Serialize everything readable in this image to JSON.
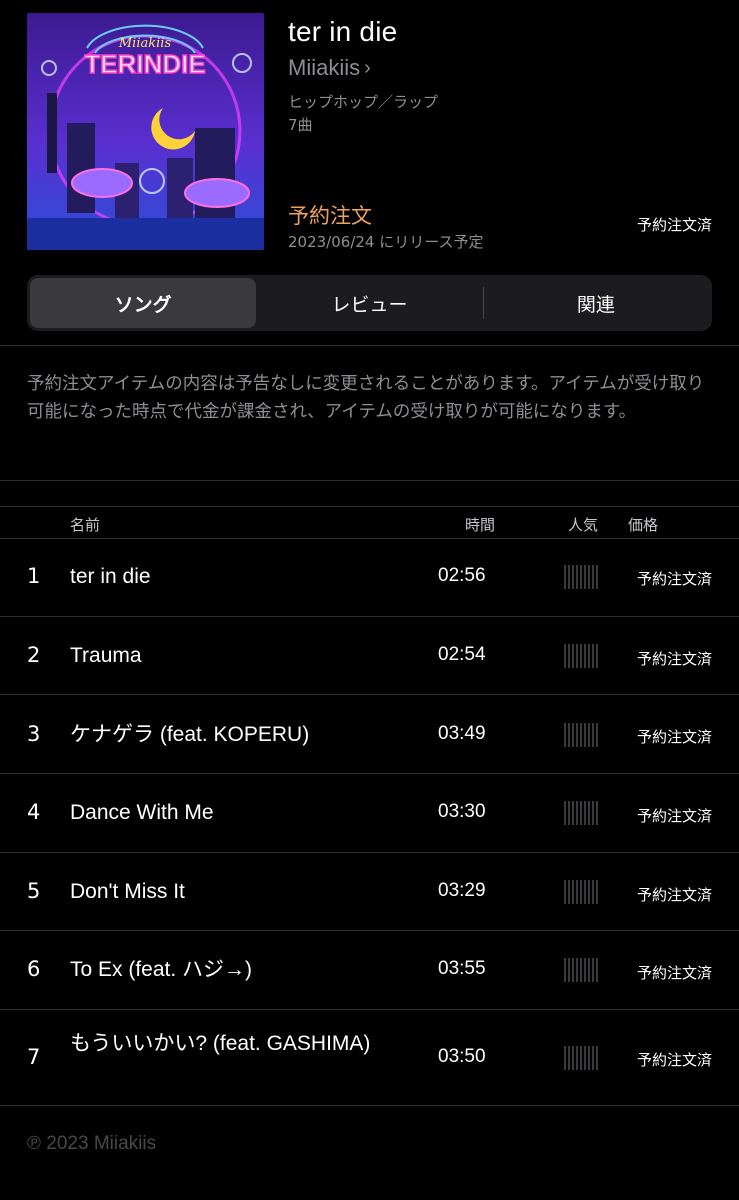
{
  "album": {
    "title": "ter in die",
    "artist": "Miiakiis",
    "genre": "ヒップホップ／ラップ",
    "track_count": "7曲",
    "preorder_label": "予約注文",
    "release_date": "2023/06/24 にリリース予定",
    "preorder_status": "予約注文済",
    "artwork_logo_small": "Miiakiis",
    "artwork_logo_big": "TERINDIE"
  },
  "tabs": [
    {
      "label": "ソング",
      "active": true
    },
    {
      "label": "レビュー",
      "active": false
    },
    {
      "label": "関連",
      "active": false
    }
  ],
  "notice": "予約注文アイテムの内容は予告なしに変更されることがあります。アイテムが受け取り可能になった時点で代金が課金され、アイテムの受け取りが可能になります。",
  "columns": {
    "name": "名前",
    "time": "時間",
    "popularity": "人気",
    "price": "価格"
  },
  "tracks": [
    {
      "num": "1",
      "name": "ter in die",
      "duration": "02:56",
      "price": "予約注文済"
    },
    {
      "num": "2",
      "name": "Trauma",
      "duration": "02:54",
      "price": "予約注文済"
    },
    {
      "num": "3",
      "name": "ケナゲラ (feat. KOPERU)",
      "duration": "03:49",
      "price": "予約注文済"
    },
    {
      "num": "4",
      "name": "Dance With Me",
      "duration": "03:30",
      "price": "予約注文済"
    },
    {
      "num": "5",
      "name": "Don't Miss It",
      "duration": "03:29",
      "price": "予約注文済"
    },
    {
      "num": "6",
      "name": "To Ex (feat. ハジ→)",
      "duration": "03:55",
      "price": "予約注文済"
    },
    {
      "num": "7",
      "name": "もういいかい? (feat. GASHIMA)",
      "duration": "03:50",
      "price": "予約注文済"
    }
  ],
  "copyright": "℗ 2023 Miiakiis",
  "colors": {
    "background": "#000000",
    "accent_preorder": "#f0a35e",
    "secondary_text": "#8e8e93",
    "segment_bg": "#1c1c1e",
    "segment_active": "#3a3a3c"
  }
}
